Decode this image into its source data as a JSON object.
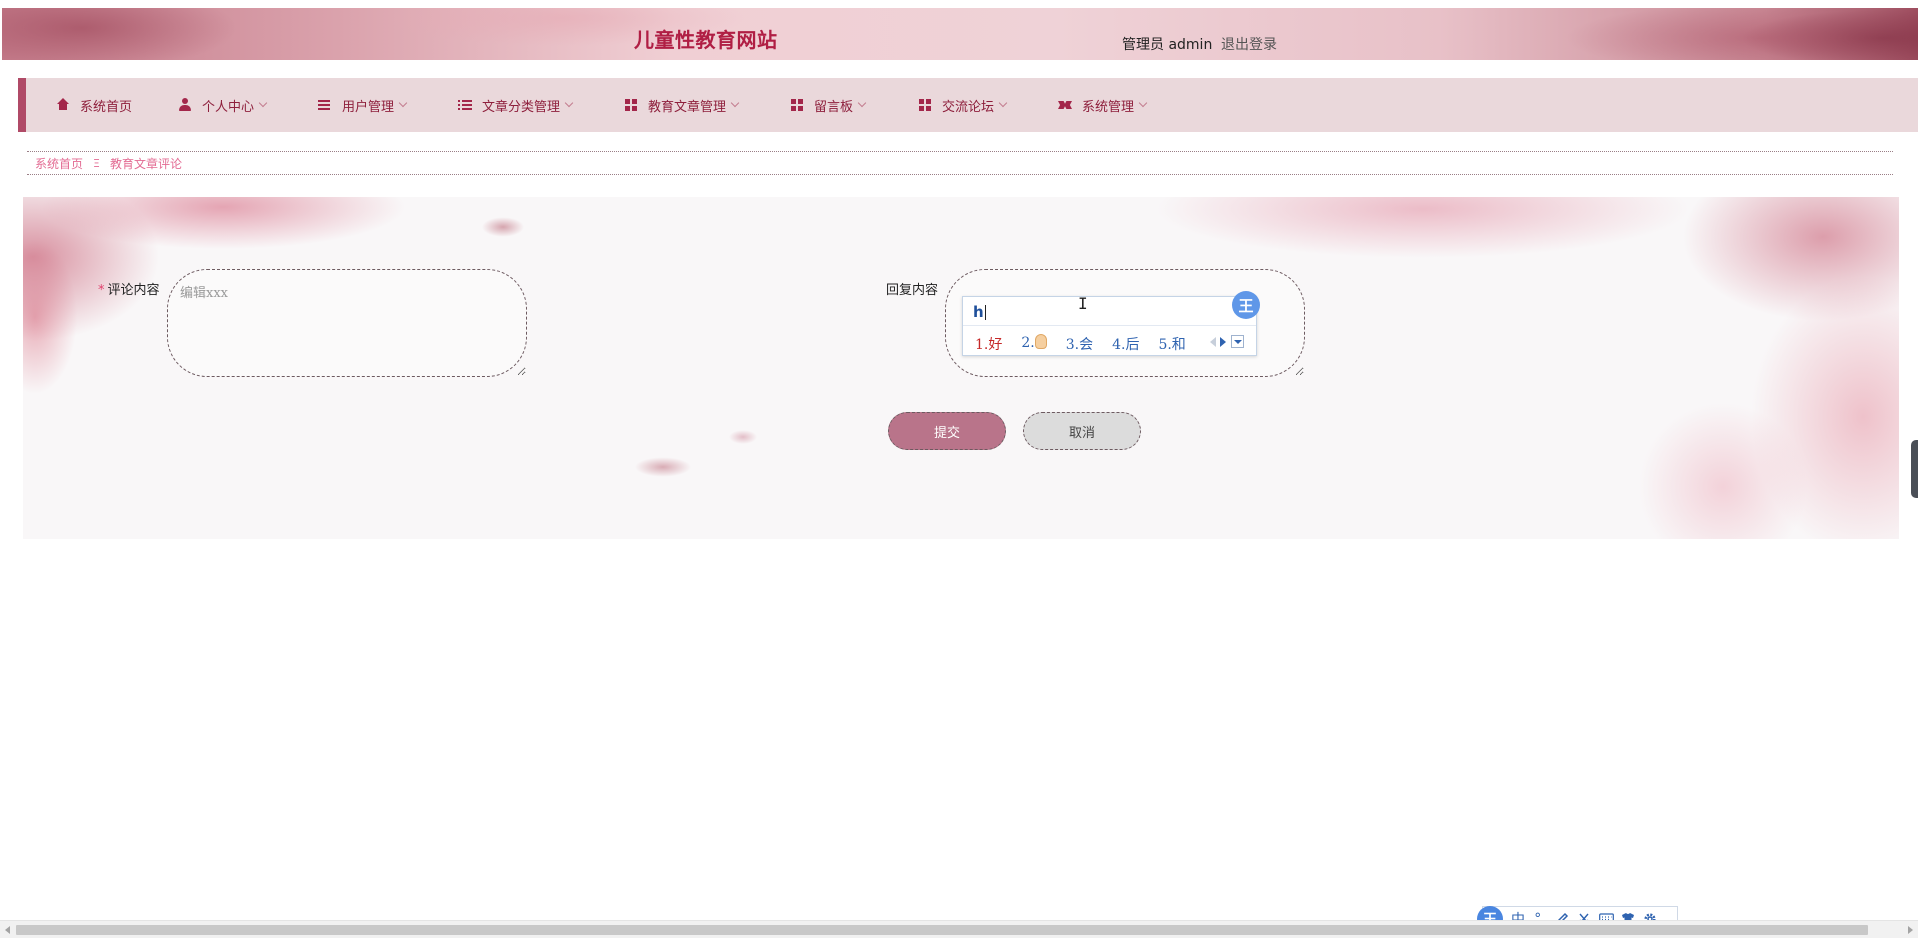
{
  "header": {
    "site_title": "儿童性教育网站",
    "admin_label": "管理员 admin",
    "logout_label": "退出登录"
  },
  "nav": {
    "items": [
      {
        "label": "系统首页",
        "icon": "home-icon",
        "dropdown": false
      },
      {
        "label": "个人中心",
        "icon": "user-icon",
        "dropdown": true
      },
      {
        "label": "用户管理",
        "icon": "bars-icon",
        "dropdown": true
      },
      {
        "label": "文章分类管理",
        "icon": "list-icon",
        "dropdown": true
      },
      {
        "label": "教育文章管理",
        "icon": "grid-icon",
        "dropdown": true
      },
      {
        "label": "留言板",
        "icon": "grid-icon",
        "dropdown": true
      },
      {
        "label": "交流论坛",
        "icon": "grid-icon",
        "dropdown": true
      },
      {
        "label": "系统管理",
        "icon": "ticket-icon",
        "dropdown": true
      }
    ]
  },
  "breadcrumb": {
    "home": "系统首页",
    "separator": "Ξ",
    "current": "教育文章评论"
  },
  "form": {
    "comment_label": "评论内容",
    "comment_required_mark": "*",
    "comment_placeholder": "编辑xxx",
    "comment_value": "",
    "reply_label": "回复内容",
    "reply_value": "",
    "submit_label": "提交",
    "cancel_label": "取消"
  },
  "ime": {
    "composition": "h",
    "badge": "王",
    "candidates": [
      {
        "index": "1.",
        "text": "好"
      },
      {
        "index": "2.",
        "text": "👌"
      },
      {
        "index": "3.",
        "text": "会"
      },
      {
        "index": "4.",
        "text": "后"
      },
      {
        "index": "5.",
        "text": "和"
      }
    ]
  },
  "ime_toolbar": {
    "logo": "王",
    "mode": "中",
    "punct": "°,",
    "items": [
      "pen-icon",
      "scissors-icon",
      "keyboard-icon",
      "shirt-icon",
      "gear-icon"
    ]
  },
  "colors": {
    "brand": "#b01e44",
    "nav_bg": "#ead8db",
    "nav_text": "#8e1f3c",
    "breadcrumb": "#e36b93",
    "submit_bg": "#b9748a",
    "cancel_bg": "#dcdcdc",
    "ime_blue": "#2f63b0"
  }
}
